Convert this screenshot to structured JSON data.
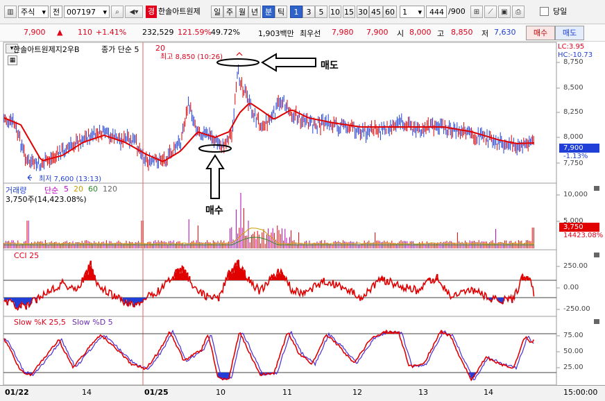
{
  "toolbar": {
    "market": "주식",
    "period_type": "전",
    "code": "007197",
    "badge": "경",
    "name": "한솔아트원제",
    "tabs": [
      "일",
      "주",
      "월",
      "년",
      "분",
      "틱"
    ],
    "active_tab": "분",
    "intervals": [
      "1",
      "3",
      "5",
      "10",
      "15",
      "30",
      "45",
      "60"
    ],
    "active_interval": "1",
    "unit_value": "1",
    "count": "444",
    "count_total": "/900",
    "same_day_label": "당일"
  },
  "quote": {
    "price": "7,900",
    "change": "110",
    "change_pct": "+1.41%",
    "volume": "232,529",
    "volume_ratio": "121.59%",
    "turnover": "49.72%",
    "amount": "1,903백만",
    "first_label": "최우선",
    "ask": "7,980",
    "bid": "7,900",
    "open_label": "시",
    "open": "8,000",
    "high_label": "고",
    "high": "8,850",
    "low_label": "저",
    "low": "7,630",
    "buy_label": "매수",
    "sell_label": "매도"
  },
  "price_panel": {
    "title": "한솔아트원제지2우B",
    "ma_label": "종가 단순 5",
    "ma_extra": "20",
    "high_note": "최고 8,850 (10:26)",
    "low_note": "최저 7,600 (13:13)",
    "sell_annotation": "매도",
    "buy_annotation": "매수",
    "lc_label": "LC:3.95",
    "hc_label": "HC:-10.73",
    "current_tag": "7,900",
    "current_change": "-1.13%",
    "y_ticks": [
      "8,750",
      "8,500",
      "8,250",
      "8,000",
      "7,750"
    ]
  },
  "volume_panel": {
    "title": "거래량",
    "ma_label": "단순",
    "ma_periods": [
      "5",
      "20",
      "60",
      "120"
    ],
    "value_label": "3,750주(14,423.08%)",
    "tag": "3,750",
    "tag2": "14423.08%",
    "y_ticks": [
      "10,000",
      "5,000"
    ]
  },
  "cci_panel": {
    "title": "CCI 25",
    "y_ticks": [
      "250.00",
      "0.00",
      "-250.00"
    ]
  },
  "stoch_panel": {
    "title_k": "Slow %K 25,5",
    "title_d": "Slow %D 5",
    "y_ticks": [
      "75.00",
      "50.00",
      "25.00"
    ]
  },
  "x_axis": {
    "labels": [
      "01/22",
      "14",
      "01/25",
      "10",
      "11",
      "12",
      "13",
      "14"
    ],
    "time": "15:00:00"
  },
  "colors": {
    "price_line": "#e00000",
    "candle": "#1f3fd6",
    "up_volume": "#e00000",
    "cci": "#e00000",
    "stoch_k": "#e00000",
    "stoch_d": "#4b2bd0"
  }
}
